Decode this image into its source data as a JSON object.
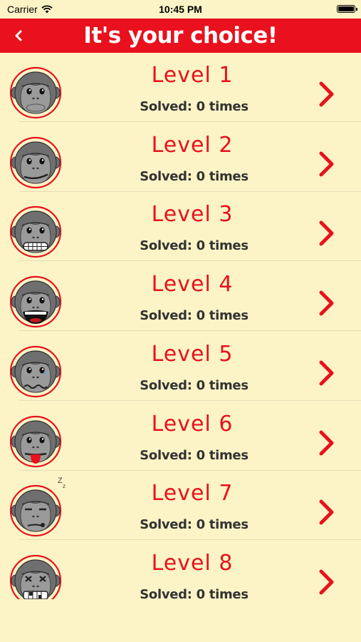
{
  "status_bar": {
    "carrier": "Carrier",
    "time": "10:45 PM"
  },
  "nav": {
    "title": "It's your choice!",
    "back_icon": "chevron-left-icon"
  },
  "colors": {
    "accent": "#e8111d",
    "background": "#fcf4c6",
    "face": "#7a7a7a"
  },
  "levels": [
    {
      "title": "Level 1",
      "solved": "Solved: 0 times",
      "face": "neutral"
    },
    {
      "title": "Level 2",
      "solved": "Solved: 0 times",
      "face": "smirk"
    },
    {
      "title": "Level 3",
      "solved": "Solved: 0 times",
      "face": "grin"
    },
    {
      "title": "Level 4",
      "solved": "Solved: 0 times",
      "face": "laugh"
    },
    {
      "title": "Level 5",
      "solved": "Solved: 0 times",
      "face": "worried"
    },
    {
      "title": "Level 6",
      "solved": "Solved: 0 times",
      "face": "tongue"
    },
    {
      "title": "Level 7",
      "solved": "Solved: 0 times",
      "face": "sleepy"
    },
    {
      "title": "Level 8",
      "solved": "Solved: 0 times",
      "face": "dizzy"
    }
  ]
}
